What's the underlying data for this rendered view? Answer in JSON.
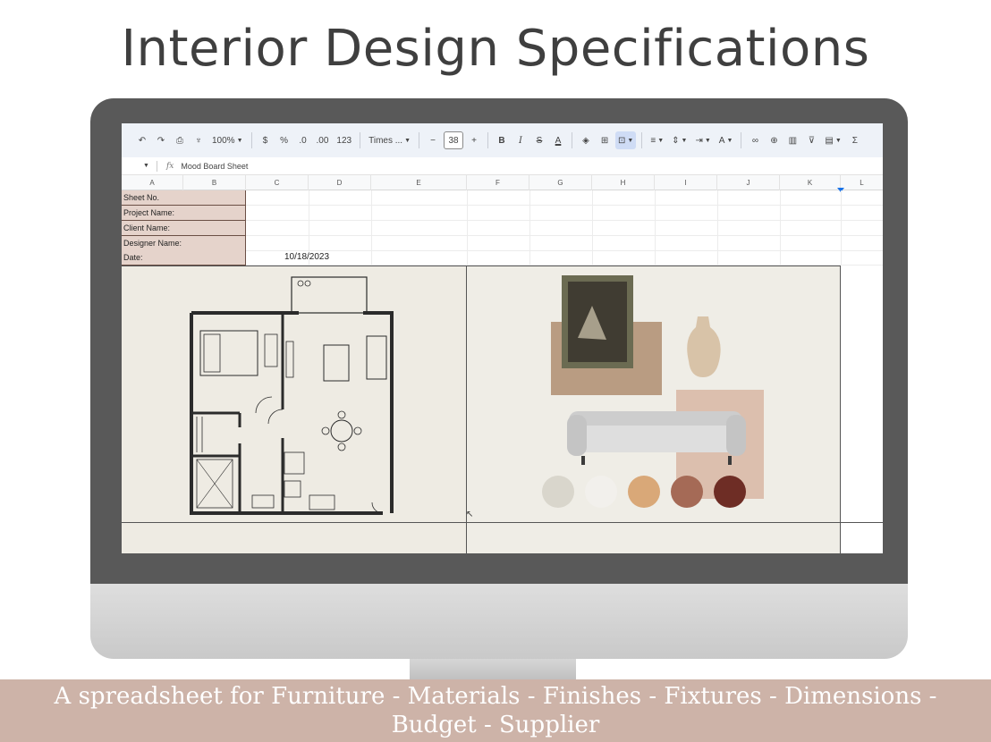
{
  "page": {
    "title": "Interior Design Specifications",
    "banner_line1": "A spreadsheet for Furniture - Materials - Finishes - Fixtures -  Dimensions -",
    "banner_line2": "Budget - Supplier"
  },
  "toolbar": {
    "zoom": "100%",
    "currency": "$",
    "percent": "%",
    "decrease_decimal": ".0",
    "increase_decimal": ".00",
    "number_format": "123",
    "font_family": "Times ...",
    "font_size": "38",
    "minus": "−",
    "plus": "+",
    "bold": "B",
    "italic": "I",
    "strike": "S",
    "text_color": "A",
    "text_color2": "A",
    "sum": "Σ"
  },
  "formula_bar": {
    "fx": "fx",
    "content": "Mood Board Sheet"
  },
  "columns": [
    "A",
    "B",
    "C",
    "D",
    "E",
    "F",
    "G",
    "H",
    "I",
    "J",
    "K",
    "L"
  ],
  "rows": [
    {
      "label": "Sheet No."
    },
    {
      "label": "Project Name:"
    },
    {
      "label": "Client Name:"
    },
    {
      "label": "Designer Name:"
    },
    {
      "label": "Date:"
    }
  ],
  "date_value": "10/18/2023",
  "colors": {
    "label_fill": "#e5d3cb",
    "banner": "#cdb3a8",
    "bezel": "#595959",
    "swatches": [
      "#d9d6cc",
      "#f2f0ec",
      "#d9a878",
      "#a56a56",
      "#6e2d25"
    ]
  },
  "images": {
    "floor_plan": "floor-plan-drawing",
    "mood_board": "mood-board-collage"
  }
}
